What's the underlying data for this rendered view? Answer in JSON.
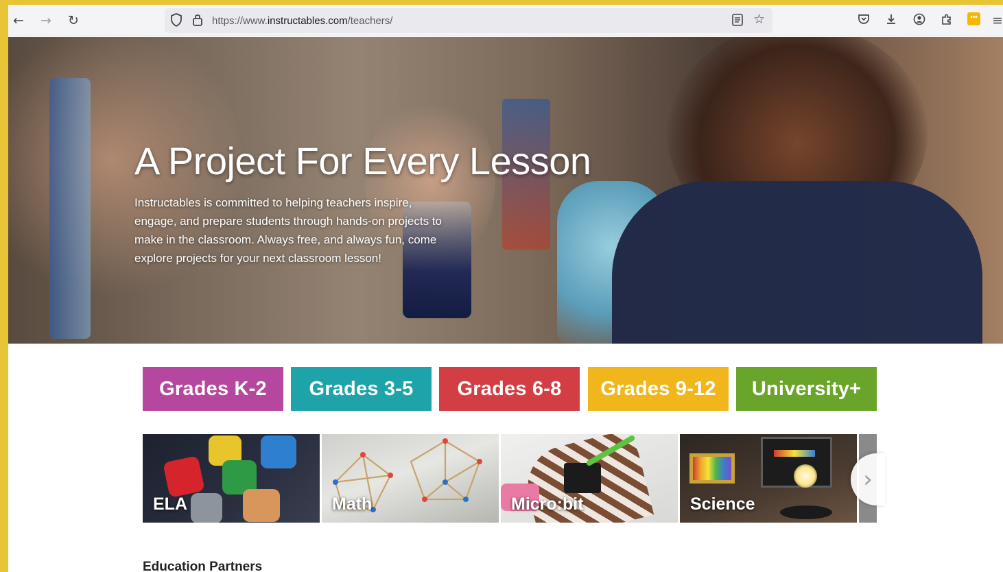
{
  "browser": {
    "url_prefix": "https://www.",
    "url_domain": "instructables.com",
    "url_path": "/teachers/",
    "icons": {
      "back": "arrow-left-icon",
      "forward": "arrow-right-icon",
      "reload": "reload-icon",
      "shield": "shield-icon",
      "lock": "lock-icon",
      "reader": "reader-view-icon",
      "bookmark": "star-icon",
      "pocket": "pocket-icon",
      "download": "download-icon",
      "account": "account-icon",
      "extensions": "puzzle-icon",
      "extension_badge": "extension-badge-icon",
      "menu": "hamburger-menu-icon"
    }
  },
  "hero": {
    "title": "A Project For Every Lesson",
    "description": "Instructables is committed to helping teachers inspire, engage, and prepare students through hands-on projects to make in the classroom. Always free, and always fun, come explore projects for your next classroom lesson!"
  },
  "grades": [
    {
      "label": "Grades K-2",
      "color": "#b5479e"
    },
    {
      "label": "Grades 3-5",
      "color": "#1fa3aa"
    },
    {
      "label": "Grades 6-8",
      "color": "#d23e44"
    },
    {
      "label": "Grades 9-12",
      "color": "#f0b61b"
    },
    {
      "label": "University+",
      "color": "#6aa52b"
    }
  ],
  "subjects": [
    {
      "label": "ELA"
    },
    {
      "label": "Math"
    },
    {
      "label": "Micro:bit"
    },
    {
      "label": "Science"
    }
  ],
  "partners": {
    "heading": "Education Partners"
  }
}
